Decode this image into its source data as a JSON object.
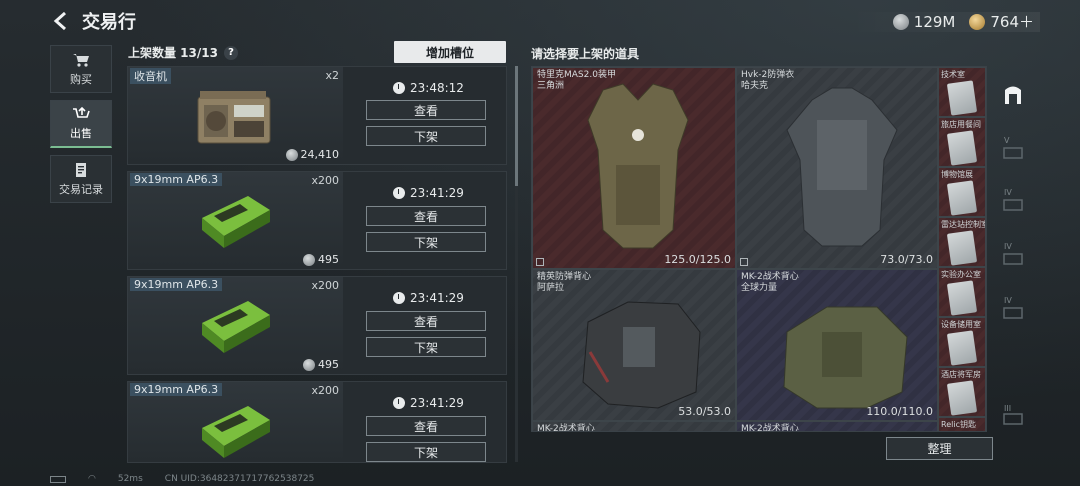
{
  "header": {
    "title": "交易行",
    "currency_silver": "129M",
    "currency_gold": "764＋"
  },
  "nav": {
    "buy": "购买",
    "sell": "出售",
    "records": "交易记录"
  },
  "listings": {
    "count_label": "上架数量 13/13",
    "help": "?",
    "add_slot": "增加槽位",
    "view_label": "查看",
    "remove_label": "下架",
    "items": [
      {
        "name": "收音机",
        "qty": "x2",
        "price": "24,410",
        "timer": "23:48:12"
      },
      {
        "name": "9x19mm AP6.3",
        "qty": "x200",
        "price": "495",
        "timer": "23:41:29"
      },
      {
        "name": "9x19mm AP6.3",
        "qty": "x200",
        "price": "495",
        "timer": "23:41:29"
      },
      {
        "name": "9x19mm AP6.3",
        "qty": "x200",
        "price": "",
        "timer": "23:41:29"
      }
    ]
  },
  "inventory": {
    "title": "请选择要上架的道具",
    "armors": [
      {
        "name": "特里克MAS2.0装甲",
        "sub": "三角洲",
        "durability": "125.0/125.0"
      },
      {
        "name": "Hvk-2防弹衣",
        "sub": "哈夫克",
        "durability": "73.0/73.0"
      },
      {
        "name": "精英防弹背心",
        "sub": "阿萨拉",
        "durability": "53.0/53.0"
      },
      {
        "name": "MK-2战术背心",
        "sub": "全球力量",
        "durability": "110.0/110.0"
      }
    ],
    "bottom_cut": [
      "MK-2战术背心",
      "MK-2战术背心"
    ],
    "keys": [
      "技术室",
      "旅店用餐间",
      "博物馆展",
      "雷达站控制室",
      "实验办公室",
      "设备储用室",
      "酒店将军房",
      "Relic钥匙"
    ],
    "sort": "整理"
  },
  "side_tabs": [
    "V",
    "IV",
    "IV",
    "IV",
    "III"
  ],
  "status": {
    "ping": "52ms",
    "uid": "CN UID:36482371717762538725"
  }
}
